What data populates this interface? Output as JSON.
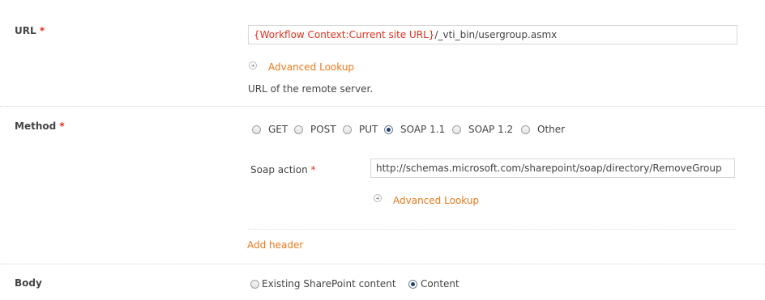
{
  "url_section": {
    "label": "URL",
    "required_mark": "*",
    "value_token": "{Workflow Context:Current site URL}",
    "value_rest": "/_vti_bin/usergroup.asmx",
    "lookup_label": "Advanced Lookup",
    "hint": "URL of the remote server."
  },
  "method_section": {
    "label": "Method",
    "required_mark": "*",
    "options": [
      {
        "label": "GET",
        "checked": false
      },
      {
        "label": "POST",
        "checked": false
      },
      {
        "label": "PUT",
        "checked": false
      },
      {
        "label": "SOAP 1.1",
        "checked": true
      },
      {
        "label": "SOAP 1.2",
        "checked": false
      },
      {
        "label": "Other",
        "checked": false
      }
    ],
    "soap_action_label": "Soap action",
    "soap_action_required": "*",
    "soap_action_value": "http://schemas.microsoft.com/sharepoint/soap/directory/RemoveGroup",
    "lookup_label": "Advanced Lookup",
    "add_header_label": "Add header"
  },
  "body_section": {
    "label": "Body",
    "options": [
      {
        "label": "Existing SharePoint content",
        "checked": false
      },
      {
        "label": "Content",
        "checked": true
      }
    ]
  },
  "colors": {
    "accent_link": "#e87a1d",
    "required_red": "#e0301e",
    "radio_checked": "#1f3f6d"
  }
}
